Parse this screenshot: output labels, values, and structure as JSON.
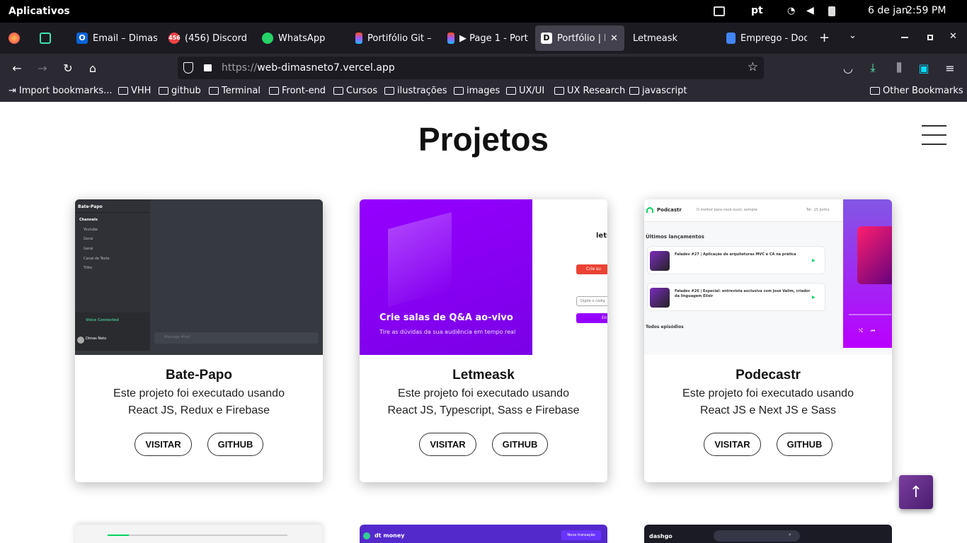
{
  "system": {
    "apps_label": "Aplicativos",
    "language": "pt",
    "date": "6 de jan",
    "time": "2:59 PM"
  },
  "tabs": [
    {
      "label": "",
      "icon": "firefox-icon"
    },
    {
      "label": "",
      "icon": "pocket-app-icon"
    },
    {
      "label": "Email – Dimas",
      "icon": "outlook-icon"
    },
    {
      "label": "(456) Discord |",
      "icon": "discord-icon",
      "badge": "456"
    },
    {
      "label": "WhatsApp",
      "icon": "whatsapp-icon"
    },
    {
      "label": "Portifólio Git –",
      "icon": "figma-icon"
    },
    {
      "label": "▶ Page 1 - Port",
      "icon": "figma-icon"
    },
    {
      "label": "Portfólio | D",
      "icon": "d-icon",
      "active": true
    },
    {
      "label": "Letmeask",
      "icon": "none"
    },
    {
      "label": "Emprego - Doc",
      "icon": "docs-icon"
    }
  ],
  "nav": {
    "url_scheme": "https://",
    "url_host": "web-dimasneto7.vercel.app"
  },
  "bookmarks": [
    "Import bookmarks...",
    "VHH",
    "github",
    "Terminal",
    "Front-end",
    "Cursos",
    "ilustrações",
    "images",
    "UX/UI",
    "UX Research",
    "javascript"
  ],
  "other_bookmarks": "Other Bookmarks",
  "page": {
    "title": "Projetos",
    "projects": [
      {
        "name": "Bate-Papo",
        "desc_line1": "Este projeto foi executado usando",
        "desc_line2": "React JS, Redux e Firebase",
        "visit": "VISITAR",
        "github": "GITHUB",
        "thumb": {
          "server": "Bate-Papo",
          "channels_header": "Channels",
          "channels": [
            "Youtube",
            "Geral",
            "Geral",
            "Canal de Teste",
            "Tribo"
          ],
          "voice": "Voice Connected",
          "user": "Dimas Neto",
          "message_placeholder": "Message #null"
        }
      },
      {
        "name": "Letmeask",
        "desc_line1": "Este projeto foi executado usando",
        "desc_line2": "React JS, Typescript, Sass e Firebase",
        "visit": "VISITAR",
        "github": "GITHUB",
        "thumb": {
          "headline": "Crie salas de Q&A ao-vivo",
          "sub": "Tire as dúvidas da sua audiência em tempo real",
          "brand": "letm",
          "google_btn": "Crie su",
          "code_placeholder": "Digite o códig",
          "enter_btn": "En"
        }
      },
      {
        "name": "Podecastr",
        "desc_line1": "Este projeto foi executado usando",
        "desc_line2": "React JS e Next JS e Sass",
        "visit": "VISITAR",
        "github": "GITHUB",
        "thumb": {
          "brand": "Podcastr",
          "tagline": "O melhor para você ouvir, sempre",
          "date": "Ter, 15 Junho",
          "latest": "Últimos lançamentos",
          "ep1": "Faladev #27 | Aplicação de arquiteturas MVC e CA na prática",
          "ep2": "Faladev #26 | Especial: entrevista exclusiva com José Valim, criador da linguagem Elixir",
          "all": "Todos episódios"
        }
      }
    ],
    "next_row": [
      {
        "label": "",
        "bg": "#f4f4f4"
      },
      {
        "label": "dt money",
        "btn": "Nova transação",
        "bg": "#5429cc"
      },
      {
        "label": "dashgo",
        "bg": "#1b1b26"
      }
    ]
  },
  "colors": {
    "purple": "#8b00ff",
    "discord_dark": "#202225",
    "podcast_purple": "#9164fa"
  }
}
